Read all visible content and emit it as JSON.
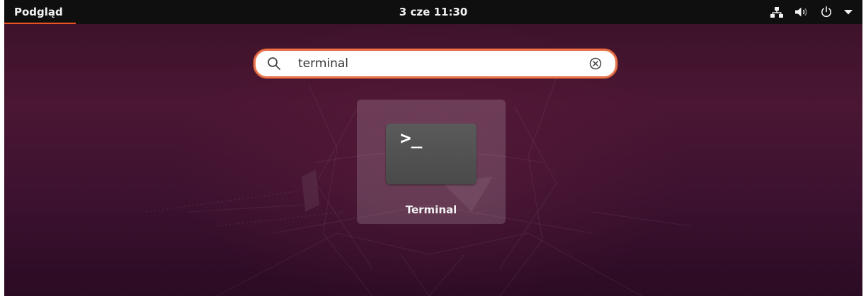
{
  "topbar": {
    "activities_label": "Podgląd",
    "clock": "3 cze  11:30",
    "tray_icons": [
      "network-icon",
      "volume-icon",
      "power-icon",
      "menu-arrow-icon"
    ]
  },
  "search": {
    "value": "terminal",
    "icon": "search-icon",
    "clear_icon": "clear-icon"
  },
  "results": [
    {
      "label": "Terminal",
      "icon": "terminal-icon",
      "icon_text": ">_"
    }
  ],
  "colors": {
    "accent": "#e95420",
    "topbar": "#0f0f0f",
    "background": "#3d1230"
  }
}
